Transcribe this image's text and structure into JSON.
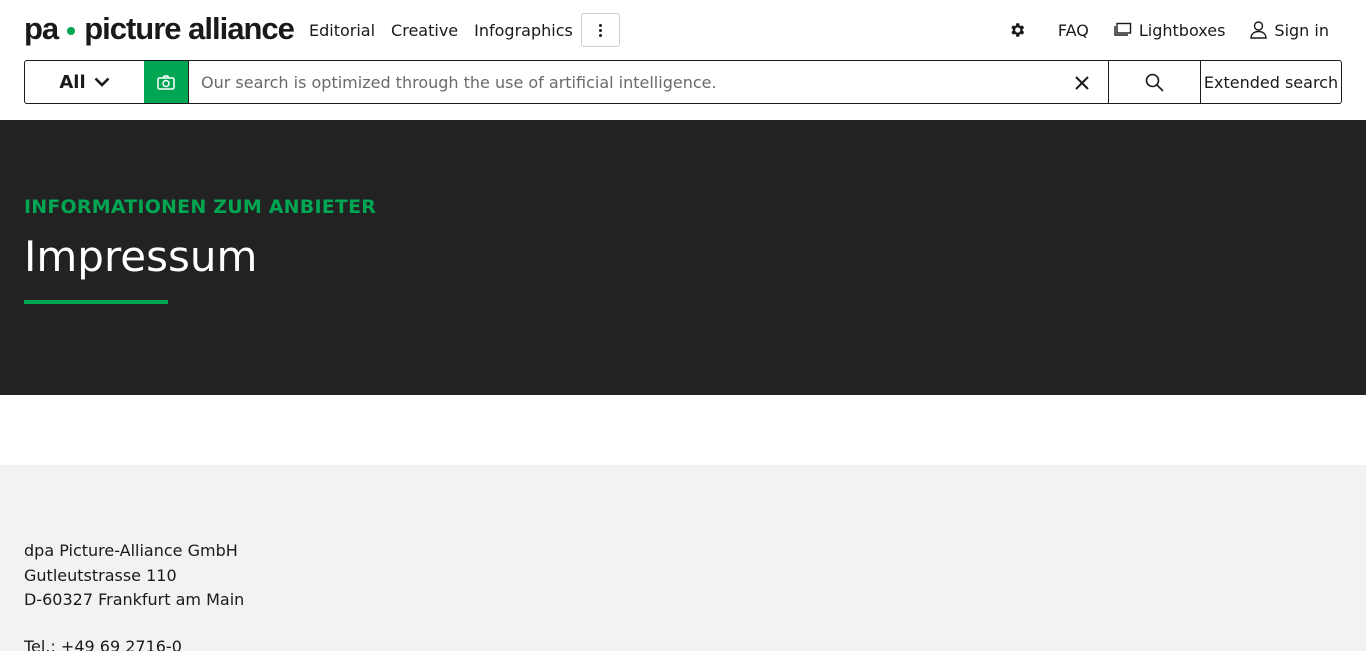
{
  "header": {
    "logo_left": "pa",
    "logo_right": "picture alliance",
    "nav": [
      {
        "label": "Editorial"
      },
      {
        "label": "Creative"
      },
      {
        "label": "Infographics"
      }
    ],
    "right": {
      "faq": "FAQ",
      "lightboxes": "Lightboxes",
      "signin": "Sign in"
    }
  },
  "search": {
    "scope": "All",
    "placeholder": "Our search is optimized through the use of artificial intelligence.",
    "extended": "Extended search"
  },
  "hero": {
    "eyebrow": "Informationen zum Anbieter",
    "title": "Impressum"
  },
  "content": {
    "company": "dpa Picture-Alliance GmbH",
    "street": "Gutleutstrasse 110",
    "city": "D-60327 Frankfurt am Main",
    "tel": "Tel.: +49 69 2716-0"
  },
  "colors": {
    "accent": "#00a651",
    "hero_bg": "#222222",
    "content_bg": "#f2f2f2"
  },
  "icons": [
    "more-vertical-icon",
    "settings-icon",
    "lightbox-icon",
    "user-icon",
    "chevron-down-icon",
    "camera-icon",
    "close-icon",
    "search-icon"
  ]
}
